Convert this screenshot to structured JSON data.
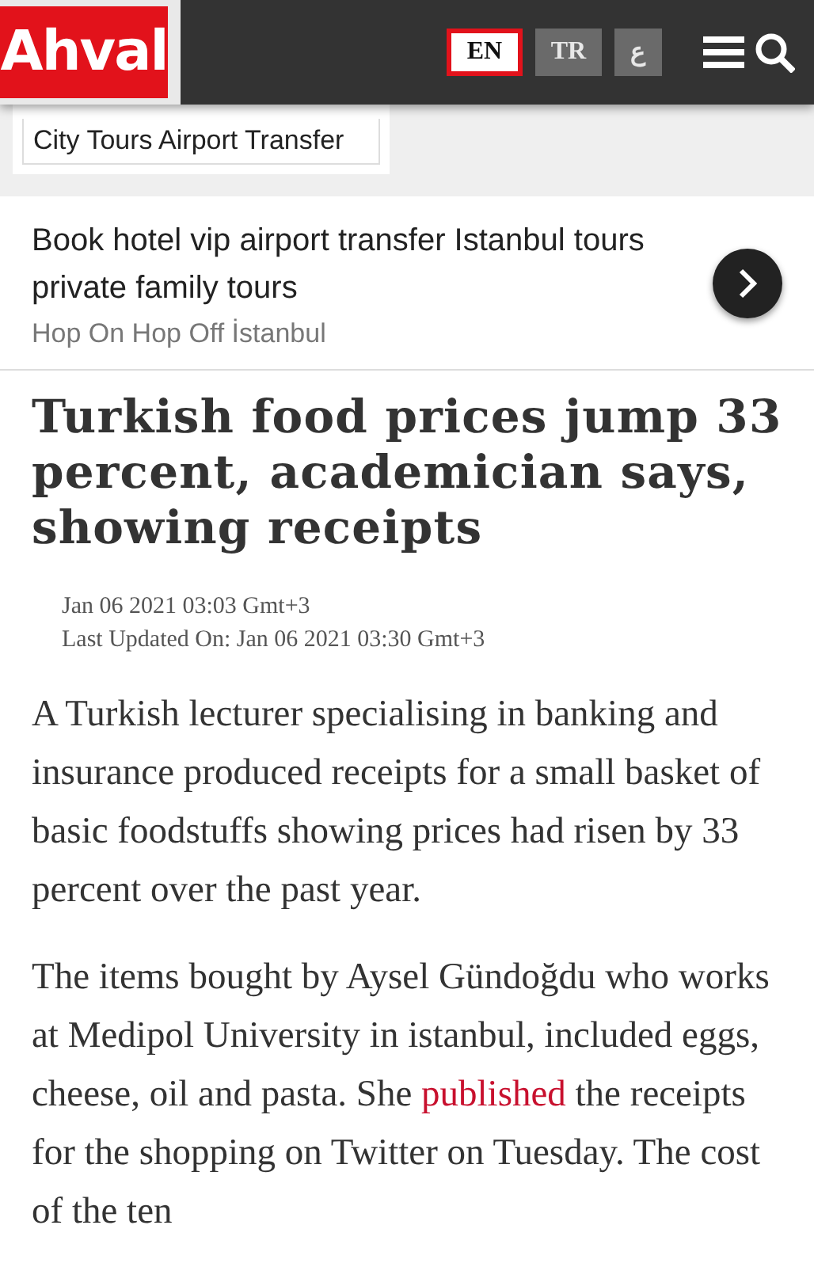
{
  "header": {
    "logo": "Ahval",
    "languages": [
      {
        "label": "EN",
        "selected": true
      },
      {
        "label": "TR",
        "selected": false
      },
      {
        "label": "ع",
        "selected": false
      }
    ]
  },
  "banner": {
    "caption": "City Tours Airport  Transfer"
  },
  "ad": {
    "text": "Book hotel vip airport transfer Istanbul tours private family tours",
    "source": "Hop On Hop Off İstanbul"
  },
  "article": {
    "title": "Turkish food prices jump 33 percent, academician says, showing receipts",
    "published": "Jan 06 2021 03:03 Gmt+3",
    "updated": "Last Updated On:  Jan 06 2021 03:30 Gmt+3",
    "paragraphs": [
      {
        "before": "A Turkish lecturer specialising in banking and insurance produced receipts for a small basket of basic foodstuffs showing prices had risen by 33 percent over the past year."
      },
      {
        "before": "The items bought by Aysel Gündoğdu who works at Medipol University in istanbul, included eggs, cheese, oil and pasta. She ",
        "link": "published",
        "after": " the receipts for the shopping on Twitter on Tuesday. The cost of the ten"
      }
    ]
  }
}
